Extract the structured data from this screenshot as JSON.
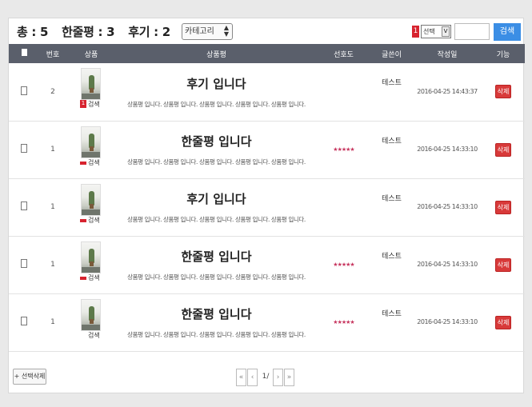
{
  "summary": {
    "total": "총 : 5",
    "oneline": "한줄평 : 3",
    "review": "후기 : 2"
  },
  "category_select": {
    "value": "카테고리"
  },
  "search": {
    "badge": "1",
    "field_select": "선택",
    "input_value": "",
    "button_label": "검색"
  },
  "table": {
    "headers": [
      "",
      "번호",
      "상품",
      "상품평",
      "선호도",
      "글쓴이",
      "작성일",
      "기능"
    ],
    "rows": [
      {
        "num": "2",
        "flag": "1",
        "search_label": "검색",
        "title": "후기 입니다",
        "body": "상품평 입니다. 상품평 입니다. 상품평 입니다. 상품평 입니다. 상품평 입니다.",
        "stars": "",
        "writer": "테스트",
        "date": "2016-04-25 14:43:37",
        "action": "삭제"
      },
      {
        "num": "1",
        "flag": "",
        "search_label": "검색",
        "title": "한줄평 입니다",
        "body": "상품평 입니다. 상품평 입니다. 상품평 입니다. 상품평 입니다. 상품평 입니다.",
        "stars": "★★★★★",
        "writer": "테스트",
        "date": "2016-04-25 14:33:10",
        "action": "삭제"
      },
      {
        "num": "1",
        "flag": "",
        "search_label": "검색",
        "title": "후기 입니다",
        "body": "상품평 입니다. 상품평 입니다. 상품평 입니다. 상품평 입니다. 상품평 입니다.",
        "stars": "",
        "writer": "테스트",
        "date": "2016-04-25 14:33:10",
        "action": "삭제"
      },
      {
        "num": "1",
        "flag": "",
        "search_label": "검색",
        "title": "한줄평 입니다",
        "body": "상품평 입니다. 상품평 입니다. 상품평 입니다. 상품평 입니다. 상품평 입니다.",
        "stars": "★★★★★",
        "writer": "테스트",
        "date": "2016-04-25 14:33:10",
        "action": "삭제"
      },
      {
        "num": "1",
        "flag": "",
        "search_label": "검색",
        "title": "한줄평 입니다",
        "body": "상품평 입니다. 상품평 입니다. 상품평 입니다. 상품평 입니다. 상품평 입니다.",
        "stars": "★★★★★",
        "writer": "테스트",
        "date": "2016-04-25 14:33:10",
        "action": "삭제"
      }
    ]
  },
  "footer": {
    "delete_selected": "+ 선택삭제",
    "pager": {
      "first": "«",
      "prev": "‹",
      "current": "1/",
      "next": "›",
      "last": "»"
    }
  },
  "colors": {
    "header_bg": "#5a5f6b",
    "search_button": "#3b8ee5",
    "delete_button": "#d83a3a",
    "stars": "#c7365f"
  }
}
